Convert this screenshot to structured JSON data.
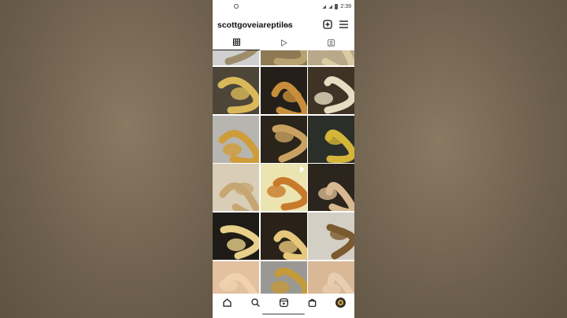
{
  "status": {
    "time": "2:39"
  },
  "header": {
    "username": "scottgoveiareptiles"
  },
  "tabs": [
    {
      "name": "grid-tab",
      "icon": "grid-icon",
      "active": true
    },
    {
      "name": "reels-tab",
      "icon": "reels-icon",
      "active": false
    },
    {
      "name": "tagged-tab",
      "icon": "tagged-icon",
      "active": false
    }
  ],
  "grid": {
    "rows": [
      [
        {
          "bg": "#cfcfcf",
          "fg": "#9c8c6a",
          "reel": false
        },
        {
          "bg": "#8d7a54",
          "fg": "#b8a270",
          "reel": false
        },
        {
          "bg": "#b9a98a",
          "fg": "#d8cca0",
          "reel": false
        }
      ],
      [
        {
          "bg": "#4d4538",
          "fg": "#d9b85a",
          "reel": false
        },
        {
          "bg": "#241f18",
          "fg": "#c88e3c",
          "reel": false
        },
        {
          "bg": "#3f3325",
          "fg": "#e6dcc2",
          "reel": false
        }
      ],
      [
        {
          "bg": "#b7b5b0",
          "fg": "#cf9c3a",
          "reel": false
        },
        {
          "bg": "#2b241b",
          "fg": "#c9a160",
          "reel": false
        },
        {
          "bg": "#2a2f2a",
          "fg": "#d4b53a",
          "reel": false
        }
      ],
      [
        {
          "bg": "#d9cdb8",
          "fg": "#c6a773",
          "reel": false
        },
        {
          "bg": "#ece4b0",
          "fg": "#c87a2a",
          "reel": true
        },
        {
          "bg": "#2b251d",
          "fg": "#d8b890",
          "reel": false
        }
      ],
      [
        {
          "bg": "#1f1b16",
          "fg": "#e8d08a",
          "reel": false
        },
        {
          "bg": "#2a2218",
          "fg": "#e6c77c",
          "reel": false
        },
        {
          "bg": "#d4cfc4",
          "fg": "#7a5a2e",
          "reel": false
        }
      ],
      [
        {
          "bg": "#e2c0a0",
          "fg": "#f0d2b0",
          "reel": false
        },
        {
          "bg": "#9a9894",
          "fg": "#c49a3a",
          "reel": false
        },
        {
          "bg": "#d8b896",
          "fg": "#e8cdb0",
          "reel": false
        }
      ]
    ]
  },
  "nav": [
    "home-icon",
    "search-icon",
    "reels-nav-icon",
    "shop-icon",
    "profile-avatar"
  ]
}
